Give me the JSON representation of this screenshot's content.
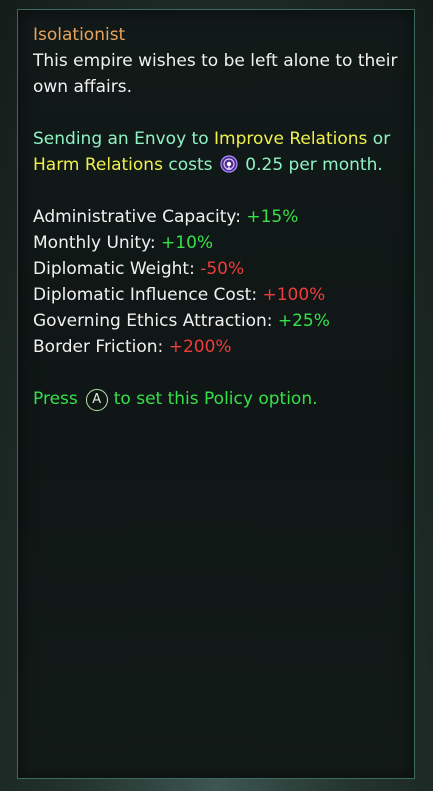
{
  "tooltip": {
    "title": "Isolationist",
    "description": "This empire wishes to be left alone to their own affairs.",
    "envoy": {
      "part1": "Sending an Envoy to ",
      "improve": "Improve Relations",
      "part2": " or ",
      "harm": "Harm Relations",
      "part3": " costs ",
      "icon": "influence-icon",
      "cost": "0.25 per month."
    },
    "stats": [
      {
        "label": "Administrative Capacity: ",
        "value": "+15%",
        "color": "#36e04a"
      },
      {
        "label": "Monthly Unity: ",
        "value": "+10%",
        "color": "#36e04a"
      },
      {
        "label": "Diplomatic Weight: ",
        "value": "-50%",
        "color": "#f03c3c"
      },
      {
        "label": "Diplomatic Influence Cost: ",
        "value": "+100%",
        "color": "#f03c3c"
      },
      {
        "label": "Governing Ethics Attraction: ",
        "value": "+25%",
        "color": "#36e04a"
      },
      {
        "label": "Border Friction: ",
        "value": "+200%",
        "color": "#f03c3c"
      }
    ],
    "hint": {
      "press": "Press",
      "button": "A",
      "rest": "to set this Policy option."
    }
  },
  "colors": {
    "title": "#e8a35a",
    "envoy": "#8ff2c2",
    "highlight": "#f0f04c",
    "positive": "#36e04a",
    "negative": "#f03c3c"
  }
}
